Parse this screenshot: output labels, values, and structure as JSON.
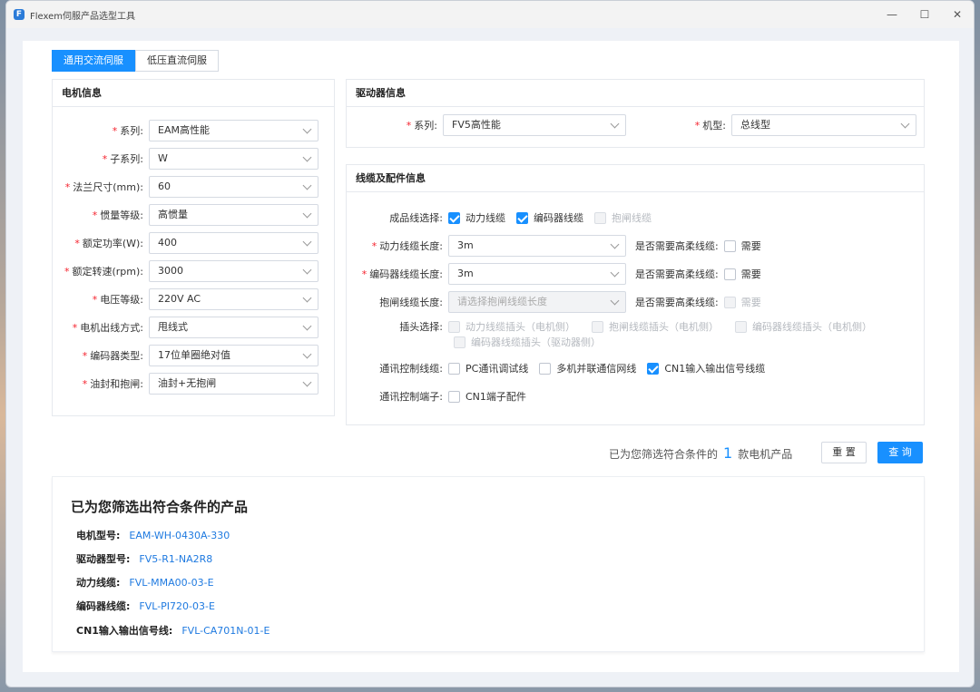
{
  "window": {
    "title": "Flexem伺服产品选型工具",
    "logo": "F"
  },
  "tabs": [
    {
      "label": "通用交流伺服",
      "active": true
    },
    {
      "label": "低压直流伺服",
      "active": false
    }
  ],
  "motor": {
    "header": "电机信息",
    "fields": [
      {
        "label": "系列:",
        "value": "EAM高性能"
      },
      {
        "label": "子系列:",
        "value": "W"
      },
      {
        "label": "法兰尺寸(mm):",
        "value": "60"
      },
      {
        "label": "惯量等级:",
        "value": "高惯量"
      },
      {
        "label": "额定功率(W):",
        "value": "400"
      },
      {
        "label": "额定转速(rpm):",
        "value": "3000"
      },
      {
        "label": "电压等级:",
        "value": "220V AC"
      },
      {
        "label": "电机出线方式:",
        "value": "甩线式"
      },
      {
        "label": "编码器类型:",
        "value": "17位单圈绝对值"
      },
      {
        "label": "油封和抱闸:",
        "value": "油封+无抱闸"
      }
    ]
  },
  "driver": {
    "header": "驱动器信息",
    "series_label": "系列:",
    "series_value": "FV5高性能",
    "model_label": "机型:",
    "model_value": "总线型"
  },
  "cable": {
    "header": "线缆及配件信息",
    "product_label": "成品线选择:",
    "product_options": [
      {
        "label": "动力线缆",
        "checked": true,
        "disabled": false
      },
      {
        "label": "编码器线缆",
        "checked": true,
        "disabled": false
      },
      {
        "label": "抱闸线缆",
        "checked": false,
        "disabled": true
      }
    ],
    "power_label": "动力线缆长度:",
    "power_value": "3m",
    "encoder_label": "编码器线缆长度:",
    "encoder_value": "3m",
    "brake_label": "抱闸线缆长度:",
    "brake_placeholder": "请选择抱闸线缆长度",
    "flex_question": "是否需要高柔线缆:",
    "flex_option": "需要",
    "plug_label": "插头选择:",
    "plug_options": [
      "动力线缆插头（电机侧）",
      "抱闸线缆插头（电机侧）",
      "编码器线缆插头（电机侧）",
      "编码器线缆插头（驱动器侧）"
    ],
    "comm_label": "通讯控制线缆:",
    "comm_options": [
      {
        "label": "PC通讯调试线",
        "checked": false
      },
      {
        "label": "多机并联通信网线",
        "checked": false
      },
      {
        "label": "CN1输入输出信号线缆",
        "checked": true
      }
    ],
    "terminal_label": "通讯控制端子:",
    "terminal_option": "CN1端子配件"
  },
  "summary": {
    "prefix": "已为您筛选符合条件的",
    "count": "1",
    "suffix": "款电机产品"
  },
  "buttons": {
    "reset": "重 置",
    "query": "查 询"
  },
  "result": {
    "title": "已为您筛选出符合条件的产品",
    "items": [
      {
        "label": "电机型号:",
        "value": "EAM-WH-0430A-330"
      },
      {
        "label": "驱动器型号:",
        "value": "FV5-R1-NA2R8"
      },
      {
        "label": "动力线缆:",
        "value": "FVL-MMA00-03-E"
      },
      {
        "label": "编码器线缆:",
        "value": "FVL-PI720-03-E"
      },
      {
        "label": "CN1输入输出信号线:",
        "value": "FVL-CA701N-01-E"
      }
    ]
  },
  "colors": {
    "accent": "#1890ff",
    "required": "#f5222d",
    "link": "#1f7ae0"
  }
}
